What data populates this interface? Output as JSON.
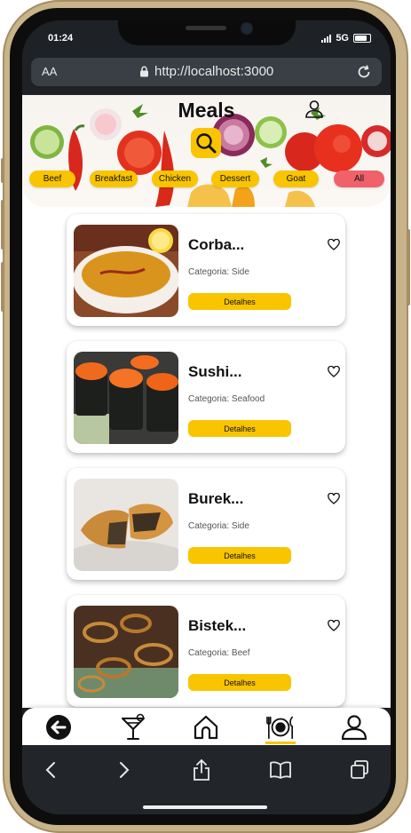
{
  "status": {
    "time": "01:24",
    "network": "5G"
  },
  "browser": {
    "aa_label": "AA",
    "url": "http://localhost:3000"
  },
  "header": {
    "title": "Meals"
  },
  "categories": [
    "Beef",
    "Breakfast",
    "Chicken",
    "Dessert",
    "Goat",
    "All"
  ],
  "meals": [
    {
      "name": "Corba...",
      "category": "Categoria: Side",
      "details_label": "Detalhes"
    },
    {
      "name": "Sushi...",
      "category": "Categoria: Seafood",
      "details_label": "Detalhes"
    },
    {
      "name": "Burek...",
      "category": "Categoria: Side",
      "details_label": "Detalhes"
    },
    {
      "name": "Bistek...",
      "category": "Categoria: Beef",
      "details_label": "Detalhes"
    }
  ],
  "bottom_nav": [
    {
      "icon": "back-arrow-icon"
    },
    {
      "icon": "cocktail-icon"
    },
    {
      "icon": "home-icon"
    },
    {
      "icon": "plate-cutlery-icon",
      "active": true
    },
    {
      "icon": "user-icon"
    }
  ],
  "browser_toolbar": [
    "back-icon",
    "forward-icon",
    "share-icon",
    "bookmarks-icon",
    "tabs-icon"
  ],
  "colors": {
    "accent": "#f9c400",
    "all_chip": "#f0616a",
    "browser_bg": "#22262b"
  }
}
